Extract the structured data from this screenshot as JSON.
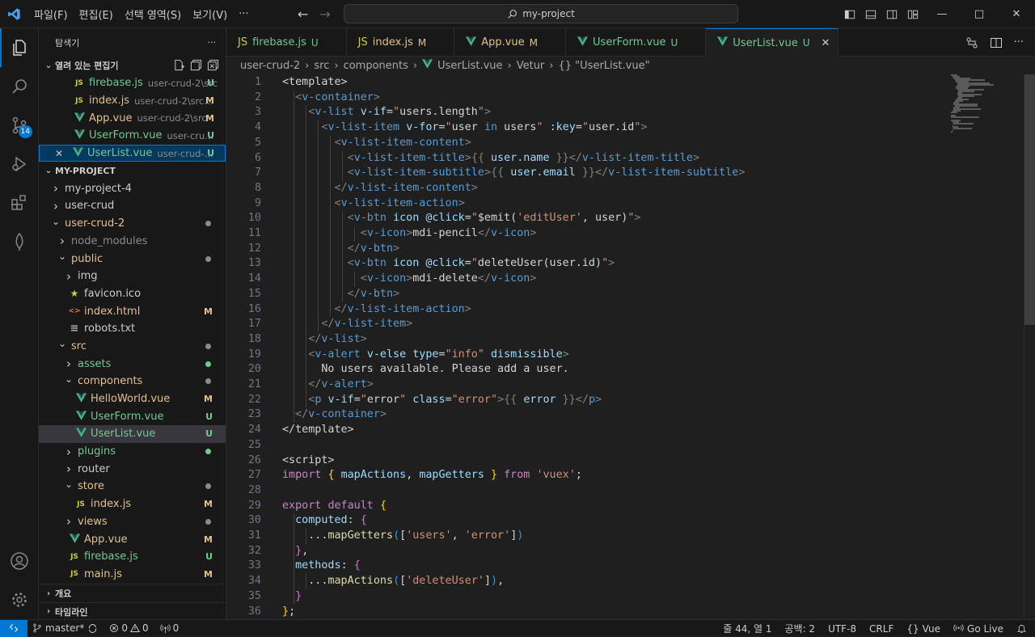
{
  "titlebar": {
    "menu": [
      "파일(F)",
      "편집(E)",
      "선택 영역(S)",
      "보기(V)",
      "···"
    ],
    "search": "my-project"
  },
  "activity": {
    "scm_badge": "14"
  },
  "sidebar": {
    "title": "탐색기",
    "more": "···",
    "open_editors_title": "열려 있는 편집기",
    "open_editors": [
      {
        "icon": "JS",
        "name": "firebase.js",
        "desc": "user-crud-2\\src",
        "status": "U"
      },
      {
        "icon": "JS",
        "name": "index.js",
        "desc": "user-crud-2\\src...",
        "status": "M"
      },
      {
        "icon": "vue",
        "name": "App.vue",
        "desc": "user-crud-2\\src",
        "status": "M"
      },
      {
        "icon": "vue",
        "name": "UserForm.vue",
        "desc": "user-cru...",
        "status": "U"
      },
      {
        "icon": "vue",
        "name": "UserList.vue",
        "desc": "user-crud-...",
        "status": "U"
      }
    ],
    "project_title": "MY-PROJECT",
    "tree": [
      {
        "name": "my-project-4",
        "type": "folder",
        "open": false,
        "depth": 0
      },
      {
        "name": "user-crud",
        "type": "file-plain",
        "depth": 0
      },
      {
        "name": "user-crud-2",
        "type": "folder",
        "open": true,
        "depth": 0,
        "dot": "#8b8b8b",
        "color": "yellow"
      },
      {
        "name": "node_modules",
        "type": "folder",
        "open": false,
        "depth": 1,
        "color": "gray"
      },
      {
        "name": "public",
        "type": "folder",
        "open": true,
        "depth": 1,
        "dot": "#8b8b8b",
        "color": "yellow"
      },
      {
        "name": "img",
        "type": "folder",
        "open": false,
        "depth": 2
      },
      {
        "name": "favicon.ico",
        "type": "star",
        "depth": 2
      },
      {
        "name": "index.html",
        "type": "html",
        "depth": 2,
        "status": "M",
        "color": "yellow"
      },
      {
        "name": "robots.txt",
        "type": "txt",
        "depth": 2
      },
      {
        "name": "src",
        "type": "folder",
        "open": true,
        "depth": 1,
        "dot": "#8b8b8b",
        "color": "yellow"
      },
      {
        "name": "assets",
        "type": "folder",
        "open": false,
        "depth": 2,
        "dot": "#73c991",
        "color": "green"
      },
      {
        "name": "components",
        "type": "folder",
        "open": true,
        "depth": 2,
        "dot": "#8b8b8b",
        "color": "yellow"
      },
      {
        "name": "HelloWorld.vue",
        "type": "vue",
        "depth": 3,
        "status": "M",
        "color": "yellow"
      },
      {
        "name": "UserForm.vue",
        "type": "vue",
        "depth": 3,
        "status": "U",
        "color": "green"
      },
      {
        "name": "UserList.vue",
        "type": "vue",
        "depth": 3,
        "status": "U",
        "color": "green",
        "current": true
      },
      {
        "name": "plugins",
        "type": "folder",
        "open": false,
        "depth": 2,
        "dot": "#73c991",
        "color": "green"
      },
      {
        "name": "router",
        "type": "folder",
        "open": false,
        "depth": 2
      },
      {
        "name": "store",
        "type": "folder",
        "open": true,
        "depth": 2,
        "dot": "#8b8b8b",
        "color": "yellow"
      },
      {
        "name": "index.js",
        "type": "js",
        "depth": 3,
        "status": "M",
        "color": "yellow"
      },
      {
        "name": "views",
        "type": "folder",
        "open": false,
        "depth": 2,
        "dot": "#8b8b8b",
        "color": "yellow"
      },
      {
        "name": "App.vue",
        "type": "vue",
        "depth": 2,
        "status": "M",
        "color": "yellow"
      },
      {
        "name": "firebase.js",
        "type": "js",
        "depth": 2,
        "status": "U",
        "color": "green"
      },
      {
        "name": "main.js",
        "type": "js",
        "depth": 2,
        "status": "M",
        "color": "yellow"
      }
    ],
    "outline_title": "개요",
    "timeline_title": "타임라인"
  },
  "tabs": [
    {
      "icon": "JS",
      "name": "firebase.js",
      "status": "U",
      "active": false
    },
    {
      "icon": "JS",
      "name": "index.js",
      "status": "M",
      "active": false
    },
    {
      "icon": "vue",
      "name": "App.vue",
      "status": "M",
      "active": false
    },
    {
      "icon": "vue",
      "name": "UserForm.vue",
      "status": "U",
      "active": false
    },
    {
      "icon": "vue",
      "name": "UserList.vue",
      "status": "U",
      "active": true
    }
  ],
  "breadcrumb": [
    "user-crud-2",
    "src",
    "components",
    "UserList.vue",
    "Vetur",
    "{} \"UserList.vue\""
  ],
  "code": [
    [
      [
        "t",
        "<template>"
      ]
    ],
    [
      [
        "g",
        "  "
      ],
      [
        "k",
        "<v-container>"
      ]
    ],
    [
      [
        "g",
        "    "
      ],
      [
        "k",
        "<v-list "
      ],
      [
        "a",
        "v-if"
      ],
      [
        "t",
        "="
      ],
      [
        "s",
        "\""
      ],
      [
        "t",
        "users.length"
      ],
      [
        "s",
        "\""
      ],
      [
        "k",
        ">"
      ]
    ],
    [
      [
        "g",
        "      "
      ],
      [
        "k",
        "<v-list-item "
      ],
      [
        "a",
        "v-for"
      ],
      [
        "t",
        "="
      ],
      [
        "s",
        "\""
      ],
      [
        "t",
        "user "
      ],
      [
        "b",
        "in"
      ],
      [
        "t",
        " users"
      ],
      [
        "s",
        "\""
      ],
      [
        "t",
        " "
      ],
      [
        "a",
        ":key"
      ],
      [
        "t",
        "="
      ],
      [
        "s",
        "\""
      ],
      [
        "t",
        "user.id"
      ],
      [
        "s",
        "\""
      ],
      [
        "k",
        ">"
      ]
    ],
    [
      [
        "g",
        "        "
      ],
      [
        "k",
        "<v-list-item-content>"
      ]
    ],
    [
      [
        "g",
        "          "
      ],
      [
        "k",
        "<v-list-item-title>"
      ],
      [
        "gr",
        "{{ "
      ],
      [
        "v",
        "user.name"
      ],
      [
        "gr",
        " }}"
      ],
      [
        "k",
        "</v-list-item-title>"
      ]
    ],
    [
      [
        "g",
        "          "
      ],
      [
        "k",
        "<v-list-item-subtitle>"
      ],
      [
        "gr",
        "{{ "
      ],
      [
        "v",
        "user.email"
      ],
      [
        "gr",
        " }}"
      ],
      [
        "k",
        "</v-list-item-subtitle>"
      ]
    ],
    [
      [
        "g",
        "        "
      ],
      [
        "k",
        "</v-list-item-content>"
      ]
    ],
    [
      [
        "g",
        "        "
      ],
      [
        "k",
        "<v-list-item-action>"
      ]
    ],
    [
      [
        "g",
        "          "
      ],
      [
        "k",
        "<v-btn "
      ],
      [
        "a",
        "icon"
      ],
      [
        "t",
        " "
      ],
      [
        "a",
        "@click"
      ],
      [
        "t",
        "="
      ],
      [
        "s",
        "\""
      ],
      [
        "t",
        "$emit("
      ],
      [
        "s",
        "'editUser'"
      ],
      [
        "t",
        ", user)"
      ],
      [
        "s",
        "\""
      ],
      [
        "k",
        ">"
      ]
    ],
    [
      [
        "g",
        "            "
      ],
      [
        "k",
        "<v-icon>"
      ],
      [
        "t",
        "mdi-pencil"
      ],
      [
        "k",
        "</v-icon>"
      ]
    ],
    [
      [
        "g",
        "          "
      ],
      [
        "k",
        "</v-btn>"
      ]
    ],
    [
      [
        "g",
        "          "
      ],
      [
        "k",
        "<v-btn "
      ],
      [
        "a",
        "icon"
      ],
      [
        "t",
        " "
      ],
      [
        "a",
        "@click"
      ],
      [
        "t",
        "="
      ],
      [
        "s",
        "\""
      ],
      [
        "t",
        "deleteUser(user.id)"
      ],
      [
        "s",
        "\""
      ],
      [
        "k",
        ">"
      ]
    ],
    [
      [
        "g",
        "            "
      ],
      [
        "k",
        "<v-icon>"
      ],
      [
        "t",
        "mdi-delete"
      ],
      [
        "k",
        "</v-icon>"
      ]
    ],
    [
      [
        "g",
        "          "
      ],
      [
        "k",
        "</v-btn>"
      ]
    ],
    [
      [
        "g",
        "        "
      ],
      [
        "k",
        "</v-list-item-action>"
      ]
    ],
    [
      [
        "g",
        "      "
      ],
      [
        "k",
        "</v-list-item>"
      ]
    ],
    [
      [
        "g",
        "    "
      ],
      [
        "k",
        "</v-list>"
      ]
    ],
    [
      [
        "g",
        "    "
      ],
      [
        "k",
        "<v-alert "
      ],
      [
        "a",
        "v-else"
      ],
      [
        "t",
        " "
      ],
      [
        "a",
        "type"
      ],
      [
        "t",
        "="
      ],
      [
        "s",
        "\"info\""
      ],
      [
        "t",
        " "
      ],
      [
        "a",
        "dismissible"
      ],
      [
        "k",
        ">"
      ]
    ],
    [
      [
        "g",
        "      "
      ],
      [
        "t",
        "No users available. Please add a user."
      ]
    ],
    [
      [
        "g",
        "    "
      ],
      [
        "k",
        "</v-alert>"
      ]
    ],
    [
      [
        "g",
        "    "
      ],
      [
        "k",
        "<p "
      ],
      [
        "a",
        "v-if"
      ],
      [
        "t",
        "="
      ],
      [
        "s",
        "\""
      ],
      [
        "t",
        "error"
      ],
      [
        "s",
        "\""
      ],
      [
        "t",
        " "
      ],
      [
        "a",
        "class"
      ],
      [
        "t",
        "="
      ],
      [
        "s",
        "\"error\""
      ],
      [
        "k",
        ">"
      ],
      [
        "gr",
        "{{ "
      ],
      [
        "v",
        "error"
      ],
      [
        "gr",
        " }}"
      ],
      [
        "k",
        "</p>"
      ]
    ],
    [
      [
        "g",
        "  "
      ],
      [
        "k",
        "</v-container>"
      ]
    ],
    [
      [
        "t",
        "</template>"
      ]
    ],
    [],
    [
      [
        "t",
        "<script>"
      ]
    ],
    [
      [
        "p",
        "import"
      ],
      [
        "t",
        " "
      ],
      [
        "y",
        "{"
      ],
      [
        "t",
        " "
      ],
      [
        "v",
        "mapActions"
      ],
      [
        "t",
        ", "
      ],
      [
        "v",
        "mapGetters"
      ],
      [
        "t",
        " "
      ],
      [
        "y",
        "}"
      ],
      [
        "t",
        " "
      ],
      [
        "p",
        "from"
      ],
      [
        "t",
        " "
      ],
      [
        "s",
        "'vuex'"
      ],
      [
        "t",
        ";"
      ]
    ],
    [],
    [
      [
        "p",
        "export"
      ],
      [
        "t",
        " "
      ],
      [
        "p",
        "default"
      ],
      [
        "t",
        " "
      ],
      [
        "y",
        "{"
      ]
    ],
    [
      [
        "g",
        "  "
      ],
      [
        "v",
        "computed"
      ],
      [
        "t",
        ": "
      ],
      [
        "m",
        "{"
      ]
    ],
    [
      [
        "g",
        "    "
      ],
      [
        "t",
        "..."
      ],
      [
        "f",
        "mapGetters"
      ],
      [
        "q",
        "("
      ],
      [
        "t",
        "["
      ],
      [
        "s",
        "'users'"
      ],
      [
        "t",
        ", "
      ],
      [
        "s",
        "'error'"
      ],
      [
        "t",
        "]"
      ],
      [
        "q",
        ")"
      ]
    ],
    [
      [
        "g",
        "  "
      ],
      [
        "m",
        "}"
      ],
      [
        "t",
        ","
      ]
    ],
    [
      [
        "g",
        "  "
      ],
      [
        "v",
        "methods"
      ],
      [
        "t",
        ": "
      ],
      [
        "m",
        "{"
      ]
    ],
    [
      [
        "g",
        "    "
      ],
      [
        "t",
        "..."
      ],
      [
        "f",
        "mapActions"
      ],
      [
        "q",
        "("
      ],
      [
        "t",
        "["
      ],
      [
        "s",
        "'deleteUser'"
      ],
      [
        "t",
        "]"
      ],
      [
        "q",
        ")"
      ],
      [
        "t",
        ","
      ]
    ],
    [
      [
        "g",
        "  "
      ],
      [
        "m",
        "}"
      ]
    ],
    [
      [
        "y",
        "}"
      ],
      [
        "t",
        ";"
      ]
    ]
  ],
  "status": {
    "branch": "master*",
    "errors": "0",
    "warnings": "0",
    "ports": "0",
    "position": "줄 44, 열 1",
    "spaces": "공백: 2",
    "encoding": "UTF-8",
    "eol": "CRLF",
    "language": "Vue",
    "golive": "Go Live"
  }
}
